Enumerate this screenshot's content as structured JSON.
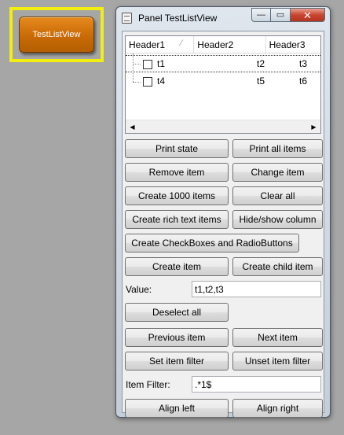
{
  "test_button": {
    "label": "TestListView"
  },
  "window": {
    "title": "Panel TestListView",
    "controls": {
      "minimize": "—",
      "maximize": "▭",
      "close": "✕"
    }
  },
  "listview": {
    "headers": [
      "Header1",
      "Header2",
      "Header3"
    ],
    "sort_indicator": "⁄",
    "rows": [
      {
        "c1": "t1",
        "c2": "t2",
        "c3": "t3",
        "checked": false
      },
      {
        "c1": "t4",
        "c2": "t5",
        "c3": "t6",
        "checked": false
      }
    ],
    "scroll_left": "◀",
    "scroll_right": "▶"
  },
  "buttons": {
    "print_state": "Print state",
    "print_all_items": "Print all items",
    "remove_item": "Remove item",
    "change_item": "Change item",
    "create_1000": "Create 1000 items",
    "clear_all": "Clear all",
    "create_rich_text": "Create rich text items",
    "hide_show_column": "Hide/show column",
    "create_checkboxes": "Create CheckBoxes and RadioButtons",
    "create_item": "Create item",
    "create_child_item": "Create child item",
    "deselect_all": "Deselect all",
    "previous_item": "Previous item",
    "next_item": "Next item",
    "set_item_filter": "Set item filter",
    "unset_item_filter": "Unset item filter",
    "align_left": "Align left",
    "align_right": "Align right"
  },
  "value_field": {
    "label": "Value:",
    "value": "t1,t2,t3"
  },
  "filter_field": {
    "label": "Item Filter:",
    "value": ".*1$"
  },
  "colors": {
    "background": "#a6a6a6",
    "highlight_frame": "#f2ee10",
    "accent_orange": "#d8780f"
  }
}
